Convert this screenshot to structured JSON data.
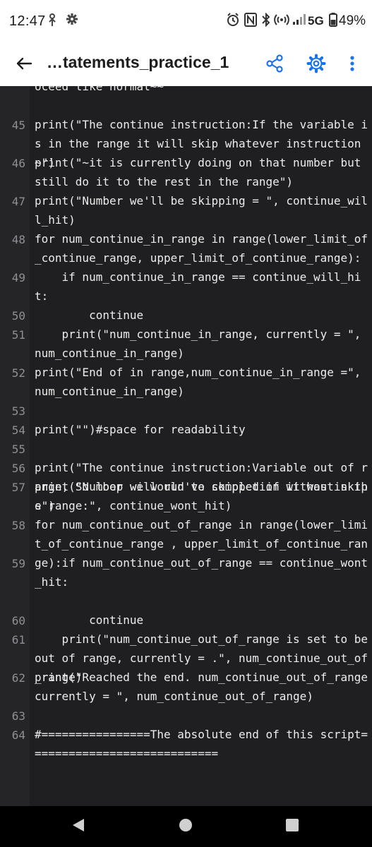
{
  "status_bar": {
    "time": "12:47",
    "network": "5G",
    "battery": "49%"
  },
  "app_bar": {
    "title": "…tatements_practice_1"
  },
  "code": [
    {
      "ln": "",
      "text": "oceed like normal~~"
    },
    {
      "ln": "45",
      "text": "print(\"The continue instruction:If the variable is in the range it will skip whatever instruction~\")"
    },
    {
      "ln": "46",
      "text": "print(\"~it is currently doing on that number but still do it to the rest in the range\")"
    },
    {
      "ln": "47",
      "text": "print(\"Number we'll be skipping = \", continue_will_hit)"
    },
    {
      "ln": "48",
      "text": "for num_continue_in_range in range(lower_limit_of_continue_range, upper_limit_of_continue_range):"
    },
    {
      "ln": "49",
      "text": "    if num_continue_in_range == continue_will_hit:"
    },
    {
      "ln": "50",
      "text": "        continue"
    },
    {
      "ln": "51",
      "text": "    print(\"num_continue_in_range, currently = \", num_continue_in_range)"
    },
    {
      "ln": "52",
      "text": "print(\"End of in range,num_continue_in_range =\", num_continue_in_range)"
    },
    {
      "ln": "53",
      "text": ""
    },
    {
      "ln": "54",
      "text": "print(\"\")#space for readability"
    },
    {
      "ln": "55",
      "text": ""
    },
    {
      "ln": "56",
      "text": "print(\"The continue instruction:Variable out of range, So loop will run to completion without skips\")"
    },
    {
      "ln": "57",
      "text": "print(\"Number we would've skipped if it was in the range:\", continue_wont_hit)"
    },
    {
      "ln": "58",
      "text": "for num_continue_out_of_range in range(lower_limit_of_continue_range , upper_limit_of_continue_range):"
    },
    {
      "ln": "59",
      "text": "    if num_continue_out_of_range == continue_wont_hit:"
    },
    {
      "ln": "60",
      "text": "        continue"
    },
    {
      "ln": "61",
      "text": "    print(\"num_continue_out_of_range is set to be out of range, currently = .\", num_continue_out_of_range)"
    },
    {
      "ln": "62",
      "text": "print(\"Reached the end. num_continue_out_of_range currently = \", num_continue_out_of_range)"
    },
    {
      "ln": "63",
      "text": ""
    },
    {
      "ln": "64",
      "text": "#================The absolute end of this script============================"
    }
  ],
  "colors": {
    "editor_bg": "#1f1f22",
    "gutter_bg": "#252528",
    "line_number": "#8f8f95",
    "code_text": "#ececec",
    "accent": "#1a73e8",
    "app_bar_bg": "#ffffff"
  }
}
